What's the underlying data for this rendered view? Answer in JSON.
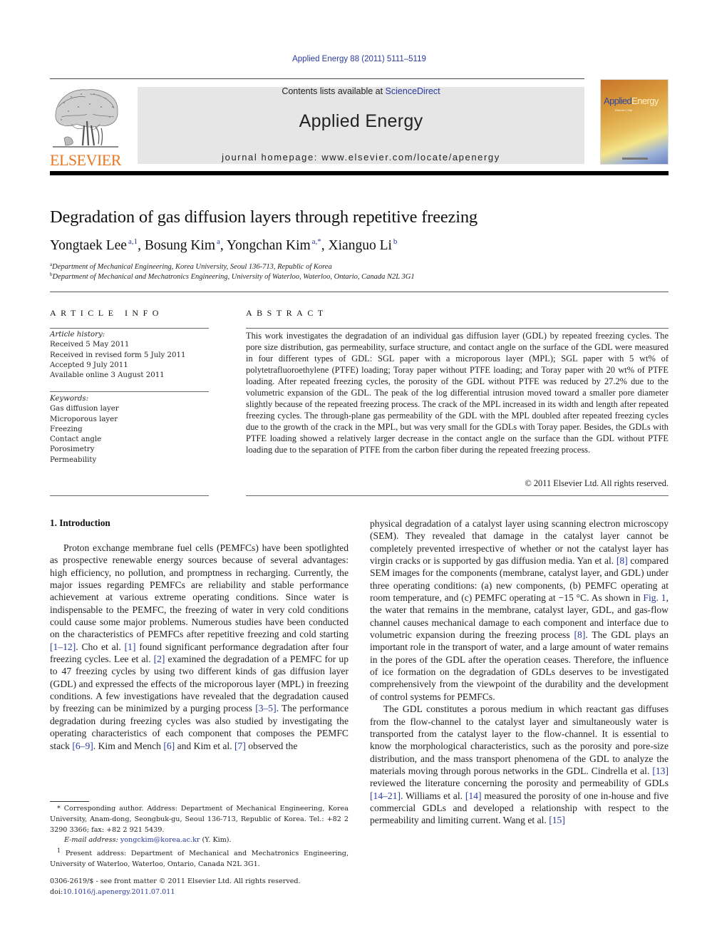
{
  "header": {
    "citation": "Applied Energy 88 (2011) 5111–5119",
    "contents_prefix": "Contents lists available at ",
    "contents_link": "ScienceDirect",
    "journal_title": "Applied Energy",
    "homepage_prefix": "journal homepage: ",
    "homepage_url": "www.elsevier.com/locate/apenergy",
    "publisher_wordmark": "ELSEVIER",
    "cover": {
      "title_part1": "Applied",
      "title_part2": "Energy",
      "subtitle": "Elsevier | Yan"
    }
  },
  "article": {
    "title": "Degradation of gas diffusion layers through repetitive freezing",
    "authors": [
      {
        "name": "Yongtaek Lee",
        "sup": "a,1"
      },
      {
        "name": "Bosung Kim",
        "sup": "a"
      },
      {
        "name": "Yongchan Kim",
        "sup": "a,*"
      },
      {
        "name": "Xianguo Li",
        "sup": "b"
      }
    ],
    "affiliations": [
      {
        "mark": "a",
        "text": "Department of Mechanical Engineering, Korea University, Seoul 136-713, Republic of Korea"
      },
      {
        "mark": "b",
        "text": "Department of Mechanical and Mechatronics Engineering, University of Waterloo, Waterloo, Ontario, Canada N2L 3G1"
      }
    ]
  },
  "article_info": {
    "heading": "ARTICLE INFO",
    "history_label": "Article history:",
    "history": [
      "Received 5 May 2011",
      "Received in revised form 5 July 2011",
      "Accepted 9 July 2011",
      "Available online 3 August 2011"
    ],
    "keywords_label": "Keywords:",
    "keywords": [
      "Gas diffusion layer",
      "Microporous layer",
      "Freezing",
      "Contact angle",
      "Porosimetry",
      "Permeability"
    ]
  },
  "abstract": {
    "heading": "ABSTRACT",
    "text": "This work investigates the degradation of an individual gas diffusion layer (GDL) by repeated freezing cycles. The pore size distribution, gas permeability, surface structure, and contact angle on the surface of the GDL were measured in four different types of GDL: SGL paper with a microporous layer (MPL); SGL paper with 5 wt% of polytetrafluoroethylene (PTFE) loading; Toray paper without PTFE loading; and Toray paper with 20 wt% of PTFE loading. After repeated freezing cycles, the porosity of the GDL with­out PTFE was reduced by 27.2% due to the volumetric expansion of the GDL. The peak of the log differ­ential intrusion moved toward a smaller pore diameter slightly because of the repeated freezing process. The crack of the MPL increased in its width and length after repeated freezing cycles. The through-plane gas permeability of the GDL with the MPL doubled after repeated freezing cycles due to the growth of the crack in the MPL, but was very small for the GDLs with Toray paper. Besides, the GDLs with PTFE loading showed a relatively larger decrease in the contact angle on the surface than the GDL without PTFE loading due to the separation of PTFE from the carbon fiber during the repeated freezing process.",
    "copyright": "© 2011 Elsevier Ltd. All rights reserved."
  },
  "body": {
    "section_heading": "1. Introduction",
    "left_column": [
      {
        "type": "text",
        "value": "Proton exchange membrane fuel cells (PEMFCs) have been spot­lighted as prospective renewable energy sources because of several advantages: high efficiency, no pollution, and promptness in recharging. Currently, the major issues regarding PEMFCs are reli­ability and stable performance achievement at various extreme operating conditions. Since water is indispensable to the PEMFC, the freezing of water in very cold conditions could cause some major problems. Numerous studies have been conducted on the characteristics of PEMFCs after repetitive freezing and cold starting "
      },
      {
        "type": "ref",
        "value": "[1–12]"
      },
      {
        "type": "text",
        "value": ". Cho et al. "
      },
      {
        "type": "ref",
        "value": "[1]"
      },
      {
        "type": "text",
        "value": " found significant performance degradation after four freezing cycles. Lee et al. "
      },
      {
        "type": "ref",
        "value": "[2]"
      },
      {
        "type": "text",
        "value": " examined the degradation of a PEMFC for up to 47 freezing cycles by using two different kinds of gas diffusion layer (GDL) and expressed the effects of the micro­porous layer (MPL) in freezing conditions. A few investigations have revealed that the degradation caused by freezing can be min­imized by a purging process "
      },
      {
        "type": "ref",
        "value": "[3–5]"
      },
      {
        "type": "text",
        "value": ". The performance degradation during freezing cycles was also studied by investigating the oper­ating characteristics of each component that composes the PEMFC stack "
      },
      {
        "type": "ref",
        "value": "[6–9]"
      },
      {
        "type": "text",
        "value": ". Kim and Mench "
      },
      {
        "type": "ref",
        "value": "[6]"
      },
      {
        "type": "text",
        "value": " and Kim et al. "
      },
      {
        "type": "ref",
        "value": "[7]"
      },
      {
        "type": "text",
        "value": " observed the"
      }
    ],
    "right_column_p1": [
      {
        "type": "text",
        "value": "physical degradation of a catalyst layer using scanning electron microscopy (SEM). They revealed that damage in the catalyst layer cannot be completely prevented irrespective of whether or not the catalyst layer has virgin cracks or is supported by gas diffusion media. Yan et al. "
      },
      {
        "type": "ref",
        "value": "[8]"
      },
      {
        "type": "text",
        "value": " compared SEM images for the components (membrane, catalyst layer, and GDL) under three operating conditions: (a) new components, (b) PEMFC operating at room temperature, and (c) PEMFC operating at −15 °C. As shown in "
      },
      {
        "type": "ref",
        "value": "Fig. 1"
      },
      {
        "type": "text",
        "value": ", the water that remains in the membrane, catalyst layer, GDL, and gas-flow channel causes mechanical damage to each component and interface due to volumetric expansion during the freezing process "
      },
      {
        "type": "ref",
        "value": "[8]"
      },
      {
        "type": "text",
        "value": ". The GDL plays an important role in the trans­port of water, and a large amount of water remains in the pores of the GDL after the operation ceases. Therefore, the influence of ice formation on the degradation of GDLs deserves to be investigated comprehensively from the viewpoint of the durability and the development of control systems for PEMFCs."
      }
    ],
    "right_column_p2": [
      {
        "type": "text",
        "value": "The GDL constitutes a porous medium in which reactant gas diffuses from the flow-channel to the catalyst layer and simulta­neously water is transported from the catalyst layer to the flow-channel. It is essential to know the morphological characteristics, such as the porosity and pore-size distribution, and the mass transport phenomena of the GDL to analyze the materials moving through porous networks in the GDL. Cindrella et al. "
      },
      {
        "type": "ref",
        "value": "[13]"
      },
      {
        "type": "text",
        "value": " reviewed the literature concerning the porosity and permeability of GDLs "
      },
      {
        "type": "ref",
        "value": "[14–21]"
      },
      {
        "type": "text",
        "value": ". Williams et al. "
      },
      {
        "type": "ref",
        "value": "[14]"
      },
      {
        "type": "text",
        "value": " measured the porosity of one in-house and five commercial GDLs and developed a relationship with respect to the permeability and limiting current. Wang et al. "
      },
      {
        "type": "ref",
        "value": "[15]"
      }
    ]
  },
  "footnotes": {
    "corresponding_mark": "*",
    "corresponding_text": "Corresponding author. Address: Department of Mechanical Engineering, Korea University, Anam-dong, Seongbuk-gu, Seoul 136-713, Republic of Korea. Tel.: +82 2 3290 3366; fax: +82 2 921 5439.",
    "email_label": "E-mail address:",
    "email": "yongckim@korea.ac.kr",
    "email_suffix": " (Y. Kim).",
    "present_mark": "1",
    "present_text": "Present address: Department of Mechanical and Mechatronics Engineering, University of Waterloo, Waterloo, Ontario, Canada N2L 3G1.",
    "front_matter": "0306-2619/$ - see front matter © 2011 Elsevier Ltd. All rights reserved.",
    "doi_label": "doi:",
    "doi": "10.1016/j.apenergy.2011.07.011"
  },
  "colors": {
    "link": "#2a3a9c",
    "elsevier_orange": "#e87722",
    "banner_gray": "#e6e6e6"
  }
}
